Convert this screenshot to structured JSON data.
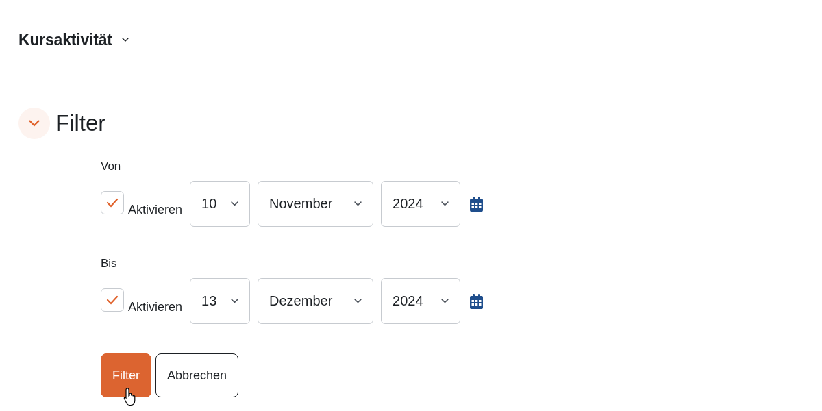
{
  "header": {
    "title": "Kursaktivität"
  },
  "section": {
    "title": "Filter",
    "expanded": true
  },
  "date_fields": [
    {
      "label": "Von",
      "checkbox_label": "Aktivieren",
      "checked": true,
      "day": "10",
      "month": "November",
      "year": "2024"
    },
    {
      "label": "Bis",
      "checkbox_label": "Aktivieren",
      "checked": true,
      "day": "13",
      "month": "Dezember",
      "year": "2024"
    }
  ],
  "buttons": [
    {
      "label": "Filter",
      "kind": "primary"
    },
    {
      "label": "Abbrechen",
      "kind": "secondary"
    }
  ]
}
